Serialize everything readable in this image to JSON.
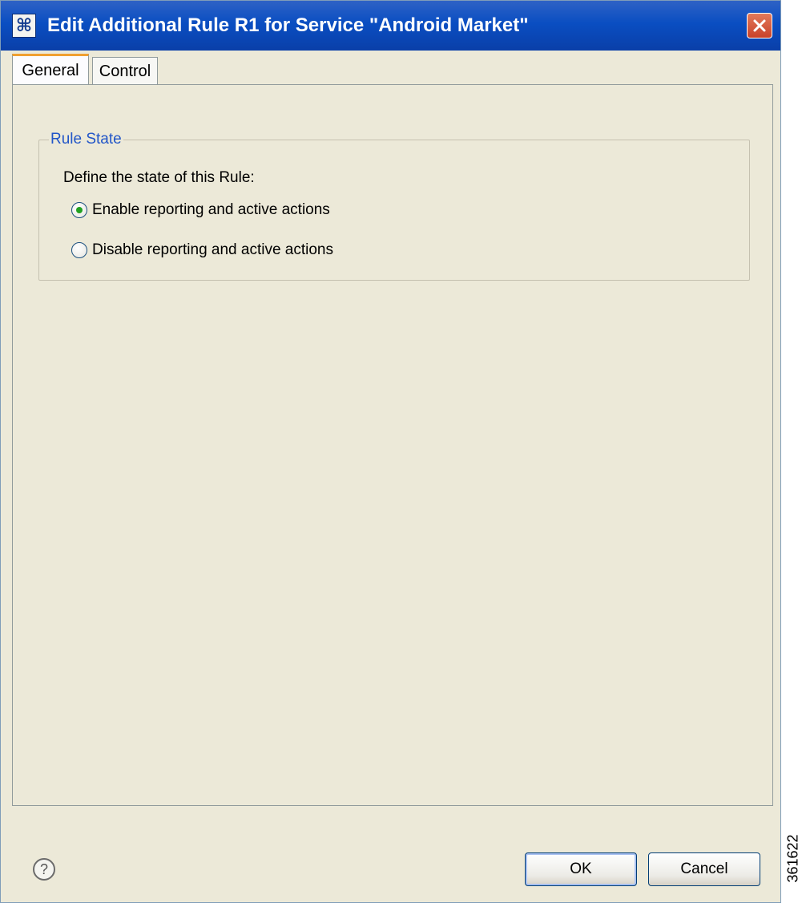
{
  "window": {
    "title": "Edit Additional Rule R1 for Service \"Android Market\"",
    "app_icon": "ꔪ"
  },
  "tabs": [
    {
      "label": "General",
      "active": true
    },
    {
      "label": "Control",
      "active": false
    }
  ],
  "rule_state": {
    "group_title": "Rule State",
    "define_label": "Define the state of this Rule:",
    "options": [
      {
        "label": "Enable reporting and active actions",
        "checked": true
      },
      {
        "label": "Disable reporting and active actions",
        "checked": false
      }
    ]
  },
  "footer": {
    "help_symbol": "?",
    "ok_label": "OK",
    "cancel_label": "Cancel"
  },
  "figure_id": "361622",
  "colors": {
    "titlebar": "#0a4ec2",
    "group_title": "#2256c8",
    "dialog_bg": "#ece9d8"
  }
}
